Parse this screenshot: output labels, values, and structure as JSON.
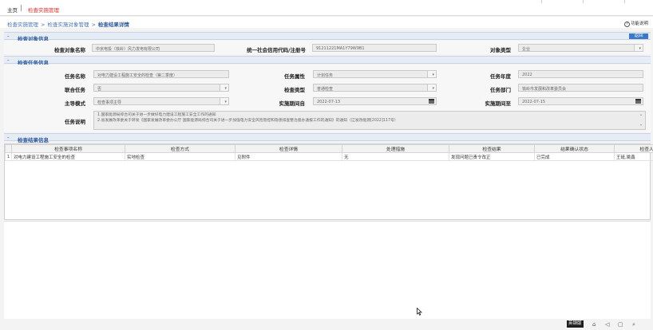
{
  "topbar": {
    "home": "主页",
    "module": "检查实施管理"
  },
  "breadcrumb": {
    "level1": "检查实施管理",
    "level2": "检查实施对象管理",
    "current": "检查结果详情"
  },
  "help": {
    "label": "功能说明",
    "icon": "question-circle-icon"
  },
  "sections": {
    "object": "检查对象信息",
    "task": "检查任务信息",
    "result": "检查结果信息"
  },
  "back_button": "返回",
  "object_info": {
    "name_label": "检查对象名称",
    "name_value": "中京电投（铁岭）风力发电有限公司",
    "credit_label": "统一社会信用代码/注册号",
    "credit_value": "91211221MA1Y79W9B1",
    "type_label": "对象类型",
    "type_value": "企业"
  },
  "task_info": {
    "task_name_label": "任务名称",
    "task_name_value": "对电力建设工程施工安全的检查（第二季度）",
    "attr_label": "任务属性",
    "attr_value": "计划任务",
    "year_label": "任务年度",
    "year_value": "2022",
    "joint_label": "联合任务",
    "joint_value": "否",
    "check_type_label": "检查类型",
    "check_type_value": "普通检查",
    "dept_label": "任务部门",
    "dept_value": "铁岭市发展和改革委员会",
    "mode_label": "主导模式",
    "mode_value": "检查事项主导",
    "start_label": "实施期间自",
    "start_value": "2022-07-13",
    "end_label": "实施期间至",
    "end_value": "2022-07-15",
    "desc_label": "任务说明",
    "desc_line1": "1.国家能源局综合司关于进一步做好电力建设工程施工安全工作的通知",
    "desc_line2": "2.省发展改革委关于转发《国家发展改革委办公厅 国家能源局综合司关于进一步加强电力安全风险管控和隐患排查整治督办通报工作的通知》的通知（辽发改能源[2022]117号）"
  },
  "result_table": {
    "columns": [
      "检查事项名称",
      "检查方式",
      "检查详情",
      "处理措施",
      "检查结果",
      "结果确认状态",
      "检查人员"
    ],
    "rows": [
      {
        "num": "1",
        "cells": [
          "对电力建设工程施工安全的检查",
          "实地检查",
          "见附件",
          "无",
          "发现问题已责令改正",
          "已完成",
          "王砥,姚鑫"
        ]
      }
    ]
  },
  "tray": {
    "ime": "英钢版"
  }
}
